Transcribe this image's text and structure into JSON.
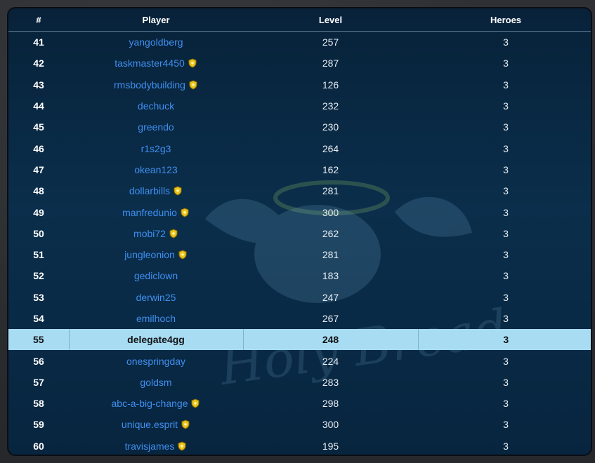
{
  "table": {
    "headers": {
      "rank": "#",
      "player": "Player",
      "level": "Level",
      "heroes": "Heroes"
    },
    "rows": [
      {
        "rank": "41",
        "player": "yangoldberg",
        "level": "257",
        "heroes": "3",
        "badge": false,
        "highlight": false
      },
      {
        "rank": "42",
        "player": "taskmaster4450",
        "level": "287",
        "heroes": "3",
        "badge": true,
        "highlight": false
      },
      {
        "rank": "43",
        "player": "rmsbodybuilding",
        "level": "126",
        "heroes": "3",
        "badge": true,
        "highlight": false
      },
      {
        "rank": "44",
        "player": "dechuck",
        "level": "232",
        "heroes": "3",
        "badge": false,
        "highlight": false
      },
      {
        "rank": "45",
        "player": "greendo",
        "level": "230",
        "heroes": "3",
        "badge": false,
        "highlight": false
      },
      {
        "rank": "46",
        "player": "r1s2g3",
        "level": "264",
        "heroes": "3",
        "badge": false,
        "highlight": false
      },
      {
        "rank": "47",
        "player": "okean123",
        "level": "162",
        "heroes": "3",
        "badge": false,
        "highlight": false
      },
      {
        "rank": "48",
        "player": "dollarbills",
        "level": "281",
        "heroes": "3",
        "badge": true,
        "highlight": false
      },
      {
        "rank": "49",
        "player": "manfredunio",
        "level": "300",
        "heroes": "3",
        "badge": true,
        "highlight": false
      },
      {
        "rank": "50",
        "player": "mobi72",
        "level": "262",
        "heroes": "3",
        "badge": true,
        "highlight": false
      },
      {
        "rank": "51",
        "player": "jungleonion",
        "level": "281",
        "heroes": "3",
        "badge": true,
        "highlight": false
      },
      {
        "rank": "52",
        "player": "gediclown",
        "level": "183",
        "heroes": "3",
        "badge": false,
        "highlight": false
      },
      {
        "rank": "53",
        "player": "derwin25",
        "level": "247",
        "heroes": "3",
        "badge": false,
        "highlight": false
      },
      {
        "rank": "54",
        "player": "emilhoch",
        "level": "267",
        "heroes": "3",
        "badge": false,
        "highlight": false
      },
      {
        "rank": "55",
        "player": "delegate4gg",
        "level": "248",
        "heroes": "3",
        "badge": false,
        "highlight": true
      },
      {
        "rank": "56",
        "player": "onespringday",
        "level": "224",
        "heroes": "3",
        "badge": false,
        "highlight": false
      },
      {
        "rank": "57",
        "player": "goldsm",
        "level": "283",
        "heroes": "3",
        "badge": false,
        "highlight": false
      },
      {
        "rank": "58",
        "player": "abc-a-big-change",
        "level": "298",
        "heroes": "3",
        "badge": true,
        "highlight": false
      },
      {
        "rank": "59",
        "player": "unique.esprit",
        "level": "300",
        "heroes": "3",
        "badge": true,
        "highlight": false
      },
      {
        "rank": "60",
        "player": "travisjames",
        "level": "195",
        "heroes": "3",
        "badge": true,
        "highlight": false
      }
    ]
  },
  "watermark_text": "Holy Bread",
  "colors": {
    "link": "#3f8ff0",
    "highlight_row": "#a7dcf3",
    "panel_bg": "#0a2e4b",
    "badge_gold": "#e8c21a"
  },
  "icons": {
    "badge": "shield-badge-icon"
  }
}
